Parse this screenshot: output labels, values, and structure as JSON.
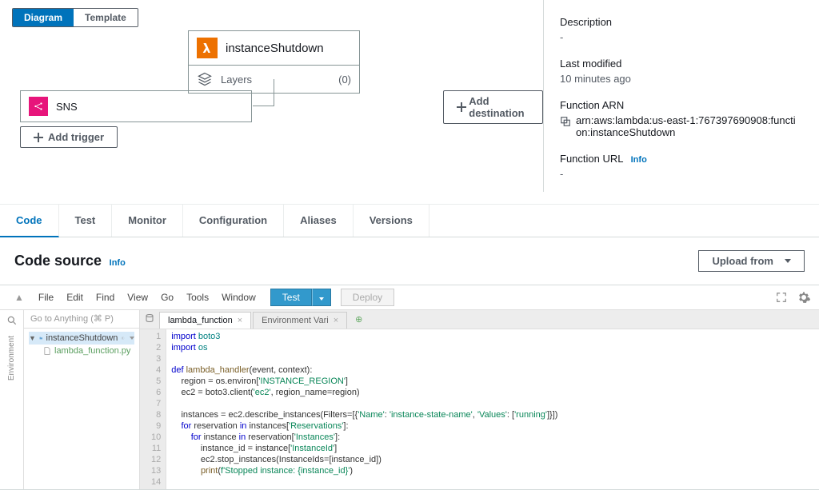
{
  "viewToggle": {
    "diagram": "Diagram",
    "template": "Template"
  },
  "function": {
    "name": "instanceShutdown",
    "layersLabel": "Layers",
    "layersCount": "(0)"
  },
  "trigger": {
    "name": "SNS"
  },
  "buttons": {
    "addDestination": "Add destination",
    "addTrigger": "Add trigger"
  },
  "infoPanel": {
    "descriptionLabel": "Description",
    "descriptionVal": "-",
    "lastModifiedLabel": "Last modified",
    "lastModifiedVal": "10 minutes ago",
    "arnLabel": "Function ARN",
    "arnVal": "arn:aws:lambda:us-east-1:767397690908:function:instanceShutdown",
    "urlLabel": "Function URL",
    "urlInfo": "Info",
    "urlVal": "-"
  },
  "tabs": [
    "Code",
    "Test",
    "Monitor",
    "Configuration",
    "Aliases",
    "Versions"
  ],
  "codeSource": {
    "title": "Code source",
    "info": "Info",
    "upload": "Upload from"
  },
  "ide": {
    "menu": [
      "File",
      "Edit",
      "Find",
      "View",
      "Go",
      "Tools",
      "Window"
    ],
    "test": "Test",
    "deploy": "Deploy",
    "goto": "Go to Anything (⌘ P)",
    "envLabel": "Environment",
    "tree": {
      "root": "instanceShutdown",
      "file": "lambda_function.py"
    },
    "fileTabs": [
      {
        "name": "lambda_function",
        "active": true
      },
      {
        "name": "Environment Vari",
        "active": false
      }
    ],
    "code": [
      {
        "n": 1,
        "seg": [
          {
            "c": "k-kw",
            "t": "import"
          },
          {
            "t": " "
          },
          {
            "c": "k-lib",
            "t": "boto3"
          }
        ]
      },
      {
        "n": 2,
        "seg": [
          {
            "c": "k-kw",
            "t": "import"
          },
          {
            "t": " "
          },
          {
            "c": "k-lib",
            "t": "os"
          }
        ]
      },
      {
        "n": 3,
        "seg": []
      },
      {
        "n": 4,
        "seg": [
          {
            "c": "k-kw",
            "t": "def"
          },
          {
            "t": " "
          },
          {
            "c": "k-fn",
            "t": "lambda_handler"
          },
          {
            "t": "(event, context):"
          }
        ]
      },
      {
        "n": 5,
        "seg": [
          {
            "t": "    region = os.environ["
          },
          {
            "c": "k-str",
            "t": "'INSTANCE_REGION'"
          },
          {
            "t": "]"
          }
        ]
      },
      {
        "n": 6,
        "seg": [
          {
            "t": "    ec2 = boto3.client("
          },
          {
            "c": "k-str",
            "t": "'ec2'"
          },
          {
            "t": ", region_name=region)"
          }
        ]
      },
      {
        "n": 7,
        "seg": []
      },
      {
        "n": 8,
        "seg": [
          {
            "t": "    instances = ec2.describe_instances(Filters=[{"
          },
          {
            "c": "k-str",
            "t": "'Name'"
          },
          {
            "t": ": "
          },
          {
            "c": "k-str",
            "t": "'instance-state-name'"
          },
          {
            "t": ", "
          },
          {
            "c": "k-str",
            "t": "'Values'"
          },
          {
            "t": ": ["
          },
          {
            "c": "k-str",
            "t": "'running'"
          },
          {
            "t": "]}])"
          }
        ]
      },
      {
        "n": 9,
        "seg": [
          {
            "t": "    "
          },
          {
            "c": "k-kw",
            "t": "for"
          },
          {
            "t": " reservation "
          },
          {
            "c": "k-kw",
            "t": "in"
          },
          {
            "t": " instances["
          },
          {
            "c": "k-str",
            "t": "'Reservations'"
          },
          {
            "t": "]:"
          }
        ]
      },
      {
        "n": 10,
        "seg": [
          {
            "t": "        "
          },
          {
            "c": "k-kw",
            "t": "for"
          },
          {
            "t": " instance "
          },
          {
            "c": "k-kw",
            "t": "in"
          },
          {
            "t": " reservation["
          },
          {
            "c": "k-str",
            "t": "'Instances'"
          },
          {
            "t": "]:"
          }
        ]
      },
      {
        "n": 11,
        "seg": [
          {
            "t": "            instance_id = instance["
          },
          {
            "c": "k-str",
            "t": "'InstanceId'"
          },
          {
            "t": "]"
          }
        ]
      },
      {
        "n": 12,
        "seg": [
          {
            "t": "            ec2.stop_instances(InstanceIds=[instance_id])"
          }
        ]
      },
      {
        "n": 13,
        "seg": [
          {
            "t": "            "
          },
          {
            "c": "k-fn",
            "t": "print"
          },
          {
            "t": "("
          },
          {
            "c": "k-str",
            "t": "f'Stopped instance: {instance_id}'"
          },
          {
            "t": ")"
          }
        ]
      },
      {
        "n": 14,
        "seg": []
      }
    ]
  }
}
